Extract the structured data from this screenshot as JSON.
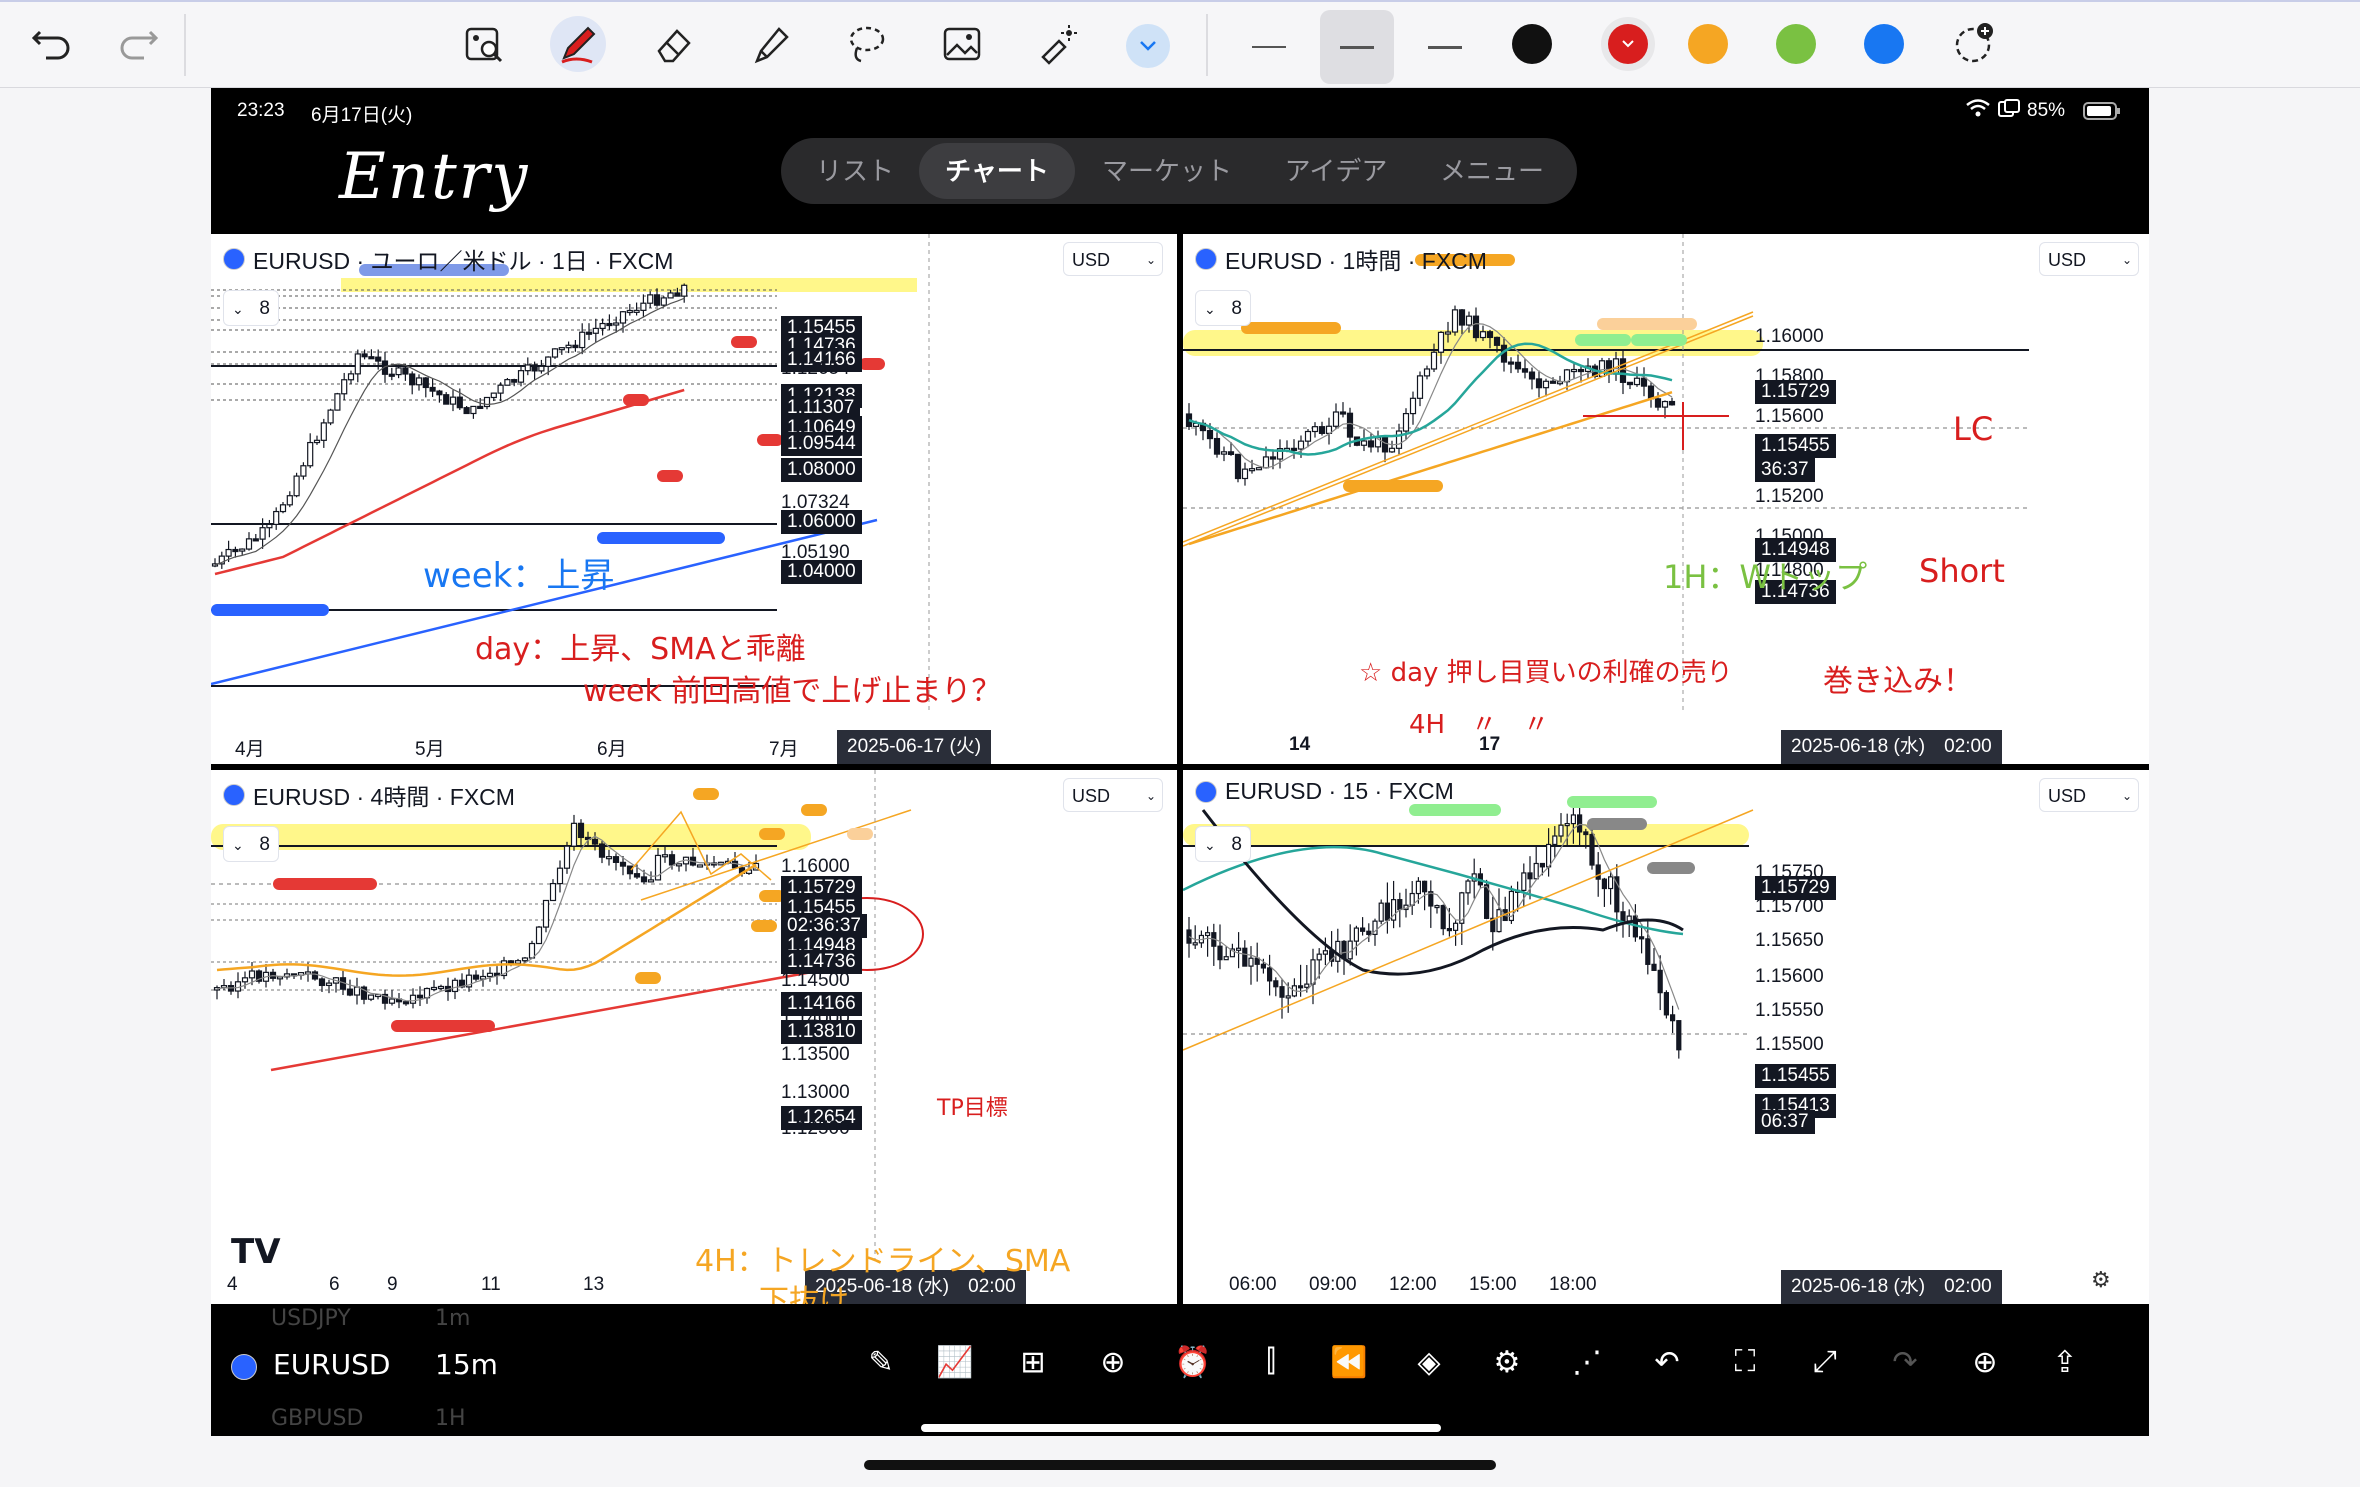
{
  "toolbar": {
    "undo": "undo-icon",
    "redo": "redo-icon",
    "tools": [
      "image-search-icon",
      "pen-icon",
      "eraser-icon",
      "highlighter-icon",
      "lasso-icon",
      "image-icon",
      "laser-pointer-icon",
      "chevron-down-icon"
    ],
    "colors": [
      "#111111",
      "#d81e1e",
      "#f5a623",
      "#7ac142",
      "#1877f2"
    ],
    "add_color": "add-color-icon"
  },
  "status": {
    "time": "23:23",
    "date": "6月17日(火)",
    "battery": "85%"
  },
  "nav": {
    "tabs": [
      "リスト",
      "チャート",
      "マーケット",
      "アイデア",
      "メニュー"
    ],
    "active": "チャート"
  },
  "handwritten": {
    "entry": "Entry"
  },
  "panes": {
    "daily": {
      "title": "EURUSD · ユーロ／米ドル · 1日 · FXCM",
      "currency": "USD",
      "indicators": "8",
      "price_labels": [
        "1.15455",
        "1.14736",
        "1.14166",
        "1.12654",
        "1.12138",
        "1.11307",
        "1.10649",
        "1.09544",
        "1.08000",
        "1.07324",
        "1.06000",
        "1.05190",
        "1.04000"
      ],
      "time_labels": [
        "4月",
        "5月",
        "6月",
        "7月"
      ],
      "time_tag": "2025-06-17 (火)",
      "notes": [
        "week：上昇",
        "day：上昇、SMAと乖離",
        "week 前回高値で上げ止まり？"
      ]
    },
    "h1": {
      "title": "EURUSD · 1時間 · FXCM",
      "currency": "USD",
      "indicators": "8",
      "price_labels": [
        "1.16000",
        "1.15800",
        "1.15729",
        "1.15600",
        "1.15455",
        "36:37",
        "1.15200",
        "1.15000",
        "1.14948",
        "1.14800",
        "1.14736"
      ],
      "time_labels": [
        "14",
        "17"
      ],
      "time_tag": "2025-06-18 (水)　02:00",
      "notes": [
        "LC",
        "Short",
        "1H：Wトップ",
        "☆ day 押し目買いの利確の売り",
        "4H　〃　〃",
        "巻き込み！"
      ]
    },
    "h4": {
      "title": "EURUSD · 4時間 · FXCM",
      "currency": "USD",
      "indicators": "8",
      "price_labels": [
        "1.16000",
        "1.15729",
        "1.15455",
        "02:36:37",
        "1.14948",
        "1.14736",
        "1.14500",
        "1.14166",
        "1.14000",
        "1.13810",
        "1.13500",
        "1.13000",
        "1.12654",
        "1.12500"
      ],
      "time_labels": [
        "4",
        "6",
        "9",
        "11",
        "13"
      ],
      "time_tag": "2025-06-18 (水)　02:00",
      "notes": [
        "TP目標",
        "4H：トレンドライン、SMA",
        "下抜け"
      ]
    },
    "m15": {
      "title": "EURUSD · 15 · FXCM",
      "currency": "USD",
      "indicators": "8",
      "price_labels": [
        "1.15750",
        "1.15729",
        "1.15700",
        "1.15650",
        "1.15600",
        "1.15550",
        "1.15500",
        "1.15455",
        "1.15413",
        "06:37"
      ],
      "time_labels": [
        "06:00",
        "09:00",
        "12:00",
        "15:00",
        "18:00"
      ],
      "time_tag": "2025-06-18 (水)　02:00"
    }
  },
  "bottom": {
    "symbol": "EURUSD",
    "interval": "15m",
    "ghost": [
      "USDJPY",
      "1m",
      "GBPUSD",
      "1H"
    ],
    "icons": [
      "draw-icon",
      "indicators-icon",
      "layout-icon",
      "add-icon",
      "alert-icon",
      "candles-icon",
      "replay-icon",
      "layers-icon",
      "settings-icon",
      "trendline-icon",
      "undo-icon",
      "fullscreen-icon",
      "expand-icon",
      "redo-icon",
      "watch-add-icon",
      "share-icon"
    ]
  }
}
